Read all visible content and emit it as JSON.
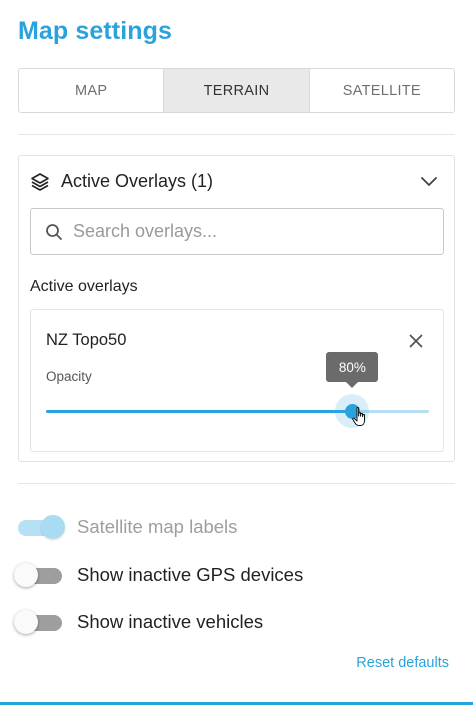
{
  "page": {
    "title": "Map settings"
  },
  "map_type": {
    "options": [
      "MAP",
      "TERRAIN",
      "SATELLITE"
    ],
    "selected": "TERRAIN"
  },
  "overlays_panel": {
    "title": "Active Overlays (1)",
    "icon": "layers-icon",
    "expand_icon": "chevron-down-icon",
    "search": {
      "placeholder": "Search overlays...",
      "value": ""
    },
    "active_heading": "Active overlays",
    "items": [
      {
        "name": "NZ Topo50",
        "opacity_label": "Opacity",
        "opacity": 0.8,
        "opacity_text": "80%"
      }
    ]
  },
  "settings": {
    "toggles": [
      {
        "label": "Satellite map labels",
        "on": true,
        "disabled": true
      },
      {
        "label": "Show inactive GPS devices",
        "on": false,
        "disabled": false
      },
      {
        "label": "Show inactive vehicles",
        "on": false,
        "disabled": false
      }
    ],
    "reset_label": "Reset defaults"
  },
  "colors": {
    "accent": "#2aa3dc",
    "selected_segment": "#e9e9e9",
    "tooltip": "#6b6b6b"
  }
}
